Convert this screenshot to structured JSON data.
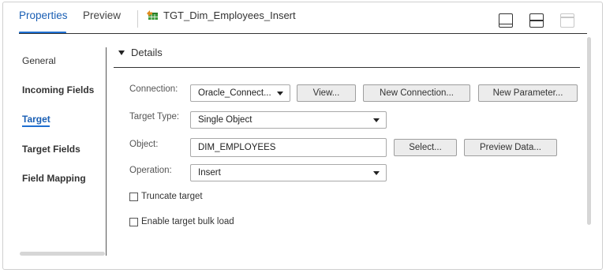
{
  "tabs": [
    {
      "label": "Properties",
      "active": true
    },
    {
      "label": "Preview",
      "active": false
    }
  ],
  "object_title": "TGT_Dim_Employees_Insert",
  "icons": {
    "object": "target-table-icon",
    "layout_bottom": "panel-bottom-layout-icon",
    "layout_middle": "panel-split-layout-icon",
    "layout_top": "panel-top-layout-icon"
  },
  "nav": {
    "items": [
      {
        "label": "General"
      },
      {
        "label": "Incoming Fields"
      },
      {
        "label": "Target"
      },
      {
        "label": "Target Fields"
      },
      {
        "label": "Field Mapping"
      }
    ],
    "active_index": 2
  },
  "details": {
    "title": "Details",
    "connection": {
      "label": "Connection:",
      "value": "Oracle_Connect...",
      "view_label": "View...",
      "new_connection_label": "New Connection...",
      "new_parameter_label": "New Parameter..."
    },
    "target_type": {
      "label": "Target Type:",
      "value": "Single Object"
    },
    "object": {
      "label": "Object:",
      "value": "DIM_EMPLOYEES",
      "select_label": "Select...",
      "preview_label": "Preview Data..."
    },
    "operation": {
      "label": "Operation:",
      "value": "Insert"
    },
    "truncate_target": {
      "label": "Truncate target",
      "checked": false
    },
    "bulk_load": {
      "label": "Enable target bulk load",
      "checked": false
    }
  },
  "colors": {
    "accent": "#1f6fd1",
    "table_icon_green": "#3a9a3a",
    "table_icon_orange": "#e08a1e"
  }
}
